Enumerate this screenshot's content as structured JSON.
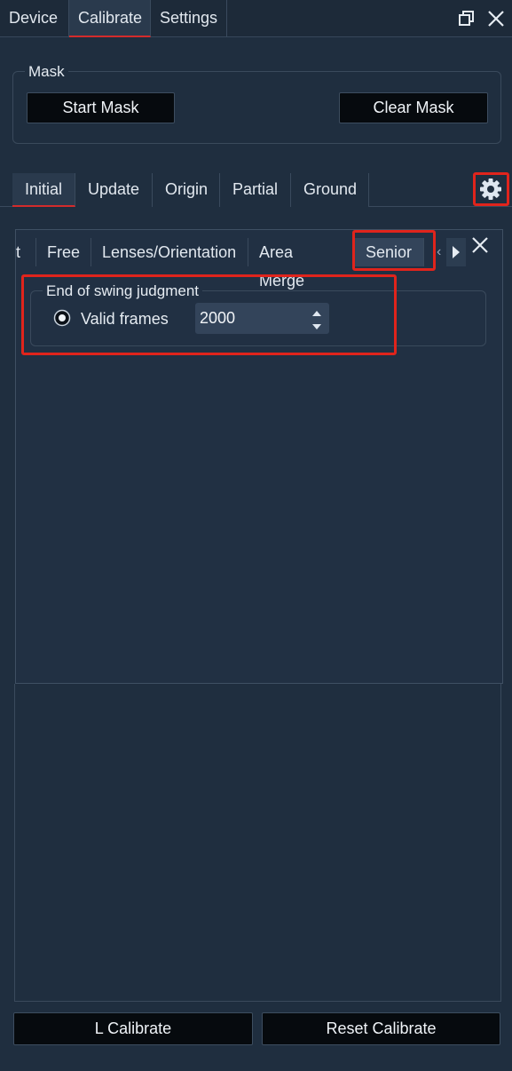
{
  "top_tabs": [
    {
      "label": "Device"
    },
    {
      "label": "Calibrate"
    },
    {
      "label": "Settings"
    }
  ],
  "mask": {
    "legend": "Mask",
    "start_label": "Start Mask",
    "clear_label": "Clear Mask"
  },
  "sub_tabs": [
    {
      "label": "Initial"
    },
    {
      "label": "Update"
    },
    {
      "label": "Origin"
    },
    {
      "label": "Partial"
    },
    {
      "label": "Ground"
    }
  ],
  "dialog": {
    "partial_tab": "t",
    "tabs": [
      {
        "label": "Free"
      },
      {
        "label": "Lenses/Orientation"
      },
      {
        "label": "Area Merge"
      },
      {
        "label": "Senior"
      }
    ],
    "group_legend": "End of swing judgment",
    "radio_label": "Valid frames",
    "frames_value": "2000"
  },
  "bottom": {
    "l_calibrate": "L Calibrate",
    "reset_calibrate": "Reset Calibrate"
  },
  "colors": {
    "background": "#1f2e3f",
    "accent_red": "#d42b2b",
    "highlight_box": "#e0241c"
  }
}
